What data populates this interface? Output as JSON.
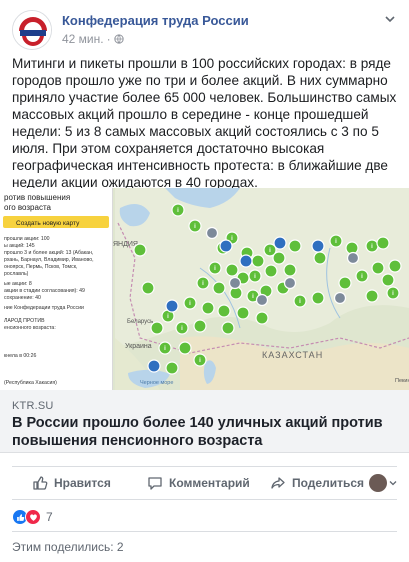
{
  "post": {
    "page_name": "Конфедерация труда России",
    "time": "42 мин.",
    "privacy_icon": "globe-icon",
    "text": "Митинги и пикеты прошли в 100 российских городах: в ряде городов прошло уже по три и более акций. В них суммарно приняло участие более 65 000 человек. Большинство самых массовых акций прошло в середине - конце прошедшей недели: 5 из 8 самых массовых акций состоялись с 3 по 5 июля. При этом сохраняется достаточно высокая географическая интенсивность протеста: в ближайшие две недели акции ожидаются в 40 городах."
  },
  "avatar": {
    "logo_text": "КОНФЕДЕРАЦИЯ ТРУДА РОССИИ"
  },
  "link_card": {
    "domain": "KTR.SU",
    "title": "В России прошло более 140 уличных акций против повышения пенсионного возраста",
    "map_image": {
      "sidebar_title": "ротив повышения\nого возраста",
      "sidebar_button": "Создать новую карту",
      "sidebar_lines": [
        "прошли акции: 100",
        "ы акций: 145",
        "прошло 3 и более акций: 13 (Абакан,",
        "рхань, Барнаул, Владимир, Иваново,",
        "оноярск, Пермь, Псков, Томск,",
        "рославль)",
        "ые акции: 8",
        "акции в стадии согласования): 49",
        "сохранение: 40",
        "ние Конфедерации труда России",
        "ЛАРОД ПРОТИВ",
        "енсионного возраста:",
        "кнела в 00:26",
        "(Республика Хакасия)"
      ],
      "map_labels": [
        "ЯНДИЯ",
        "Беларусь",
        "Украина",
        "КАЗАХСТАН",
        "Черное море",
        "Пекин"
      ]
    }
  },
  "actions": {
    "like": "Нравится",
    "comment": "Комментарий",
    "share": "Поделиться"
  },
  "reactions": {
    "count": "7"
  },
  "shares": {
    "text": "Этим поделились: 2"
  },
  "colors": {
    "link_blue": "#385898",
    "gray_text": "#606770",
    "like_blue": "#1877f2",
    "love_red": "#f0284a",
    "pin_green": "#5fbf3a"
  }
}
